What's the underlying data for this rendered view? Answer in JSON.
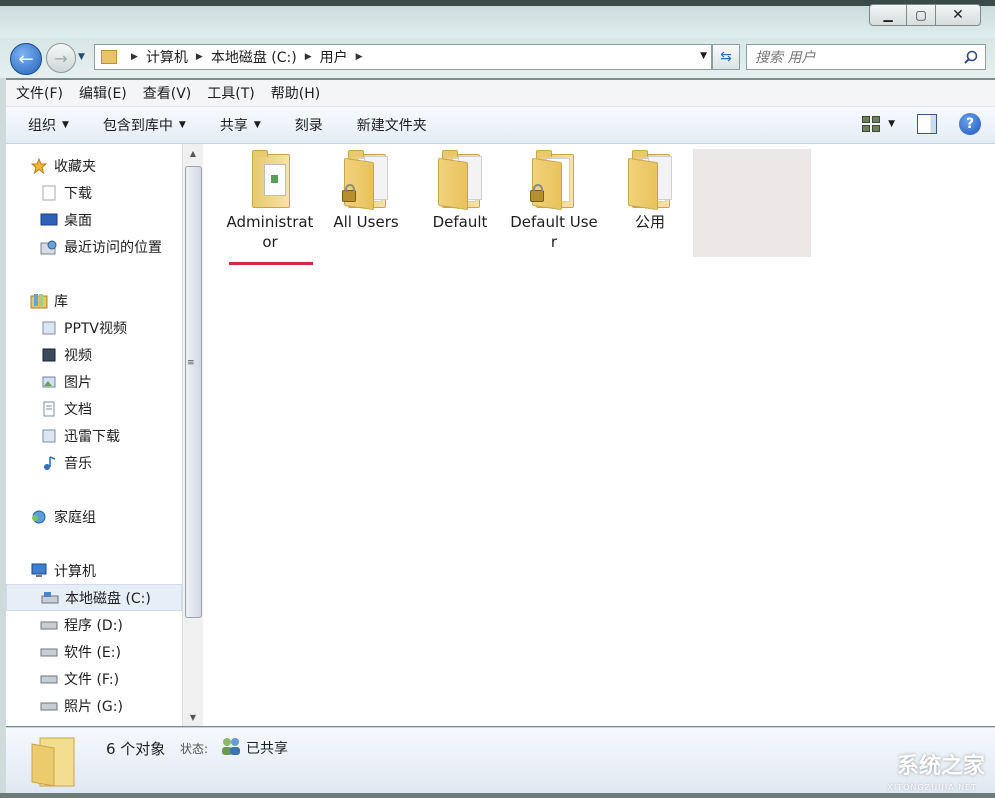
{
  "window": {
    "min_glyph": "▁",
    "max_glyph": "▢",
    "close_glyph": "✕"
  },
  "nav": {
    "back_glyph": "←",
    "forward_glyph": "→",
    "history_glyph": "▼",
    "refresh_glyph": "⇆"
  },
  "address": {
    "crumbs": [
      "计算机",
      "本地磁盘 (C:)",
      "用户"
    ],
    "arrow": "▶",
    "drop": "▼"
  },
  "search": {
    "placeholder": "搜索 用户"
  },
  "menu": [
    "文件(F)",
    "编辑(E)",
    "查看(V)",
    "工具(T)",
    "帮助(H)"
  ],
  "toolbar": {
    "organize": "组织",
    "include": "包含到库中",
    "share": "共享",
    "burn": "刻录",
    "new_folder": "新建文件夹",
    "caret": "▼",
    "help_glyph": "?"
  },
  "sidebar": {
    "favorites": {
      "title": "收藏夹",
      "items": [
        "下载",
        "桌面",
        "最近访问的位置"
      ]
    },
    "libraries": {
      "title": "库",
      "items": [
        "PPTV视频",
        "视频",
        "图片",
        "文档",
        "迅雷下载",
        "音乐"
      ]
    },
    "homegroup": "家庭组",
    "computer": {
      "title": "计算机",
      "items": [
        "本地磁盘 (C:)",
        "程序 (D:)",
        "软件 (E:)",
        "文件 (F:)",
        "照片 (G:)"
      ],
      "selected": "本地磁盘 (C:)"
    }
  },
  "scroll": {
    "up": "▲",
    "down": "▼",
    "grip": "≡"
  },
  "files": [
    {
      "name": "Administrator",
      "locked": false,
      "personal": true
    },
    {
      "name": "All Users",
      "locked": true,
      "personal": false
    },
    {
      "name": "Default",
      "locked": false,
      "personal": false
    },
    {
      "name": "Default User",
      "locked": true,
      "personal": false
    },
    {
      "name": "公用",
      "locked": false,
      "personal": false
    }
  ],
  "status": {
    "count": "6 个对象",
    "state_label": "状态:",
    "state_value": "已共享"
  },
  "watermark": {
    "text": "系统之家",
    "sub": "XITONGZHIJIA.NET"
  },
  "colors": {
    "accent_underline": "#d32a3c",
    "folder": "#e9c96e",
    "selection": "#e6eef7"
  }
}
